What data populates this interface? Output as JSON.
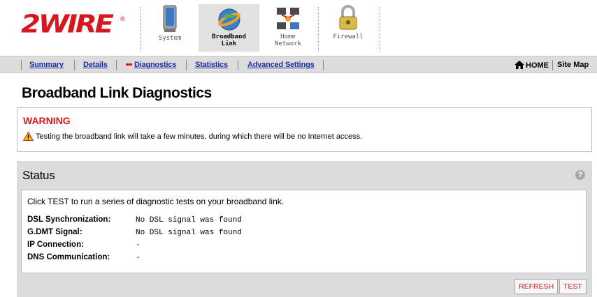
{
  "brand": {
    "logo_text": "2WIRE",
    "tm": "®"
  },
  "tabs": [
    {
      "label_line1": "System",
      "label_line2": "",
      "icon": "computer-icon"
    },
    {
      "label_line1": "Broadband",
      "label_line2": "Link",
      "icon": "globe-icon"
    },
    {
      "label_line1": "Home",
      "label_line2": "Network",
      "icon": "network-icon"
    },
    {
      "label_line1": "Firewall",
      "label_line2": "",
      "icon": "padlock-icon"
    }
  ],
  "nav": {
    "items": [
      {
        "label": "Summary"
      },
      {
        "label": "Details"
      },
      {
        "label": "Diagnostics"
      },
      {
        "label": "Statistics"
      },
      {
        "label": "Advanced Settings"
      }
    ],
    "home_label": "HOME",
    "sitemap_label": "Site Map"
  },
  "page_title": "Broadband Link Diagnostics",
  "warning": {
    "title": "WARNING",
    "text": "Testing the broadband link will take a few minutes, during which there will be no Internet access."
  },
  "status": {
    "title": "Status",
    "help_glyph": "?",
    "intro": "Click TEST to run a series of diagnostic tests on your broadband link.",
    "rows": [
      {
        "label": "DSL Synchronization:",
        "value": "No DSL signal was found"
      },
      {
        "label": "G.DMT Signal:",
        "value": "No DSL signal was found"
      },
      {
        "label": "IP Connection:",
        "value": "-"
      },
      {
        "label": "DNS Communication:",
        "value": "-"
      }
    ],
    "refresh_label": "REFRESH",
    "test_label": "TEST"
  },
  "colors": {
    "brand_red": "#d6181e",
    "link_blue": "#1d2ea7",
    "panel_gray": "#dbdbdb"
  }
}
